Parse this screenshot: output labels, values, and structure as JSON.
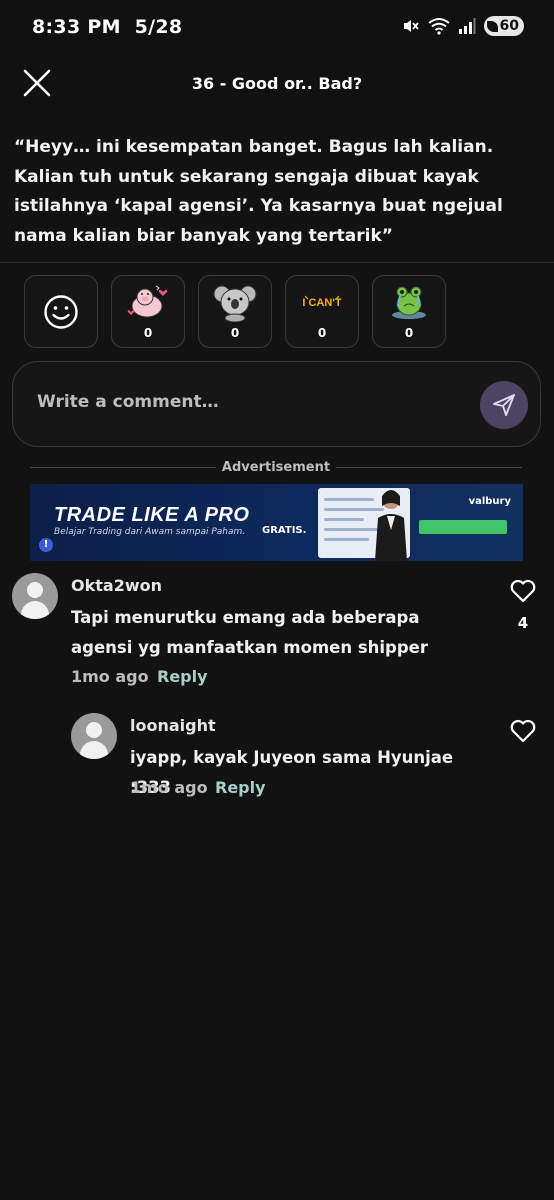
{
  "status_bar": {
    "time": "8:33 PM",
    "date": "5/28",
    "battery": "60",
    "icons": [
      "mute-icon",
      "wifi-icon",
      "signal-icon",
      "battery-icon"
    ]
  },
  "header": {
    "title": "36 - Good or.. Bad?",
    "close_icon": "close-icon"
  },
  "quote": {
    "text": "“Heyy… ini kesempatan banget. Bagus lah kalian. Kalian tuh untuk sekarang sengaja dibuat kayak istilahnya ‘kapal agensi’. Ya kasarnya buat ngejual nama kalian biar banyak yang tertarik”"
  },
  "reactions": {
    "add_icon": "smiley-face-icon",
    "items": [
      {
        "sticker": "pig-love-sticker",
        "count": "0"
      },
      {
        "sticker": "koala-sticker",
        "count": "0"
      },
      {
        "sticker": "i-cant-sticker",
        "label": "I CAN'T",
        "count": "0"
      },
      {
        "sticker": "frog-crying-sticker",
        "count": "0"
      }
    ]
  },
  "comment_box": {
    "placeholder": "Write a comment…",
    "send_icon": "send-icon"
  },
  "advertisement": {
    "label": "Advertisement",
    "headline": "TRADE LIKE A PRO",
    "subline": "Belajar Trading dari Awam sampai Paham.",
    "gratis": "GRATIS."
  },
  "comments": [
    {
      "author": "Okta2won",
      "text": "Tapi menurutku emang  ada beberapa agensi yg manfaatkan momen shipper",
      "time": "1mo ago",
      "reply_label": "Reply",
      "likes": "4"
    },
    {
      "author": "loonaight",
      "text": "iyapp, kayak Juyeon sama Hyunjae :333",
      "time": "1mo ago",
      "reply_label": "Reply",
      "likes": ""
    }
  ],
  "colors": {
    "background": "#121212",
    "accent_send": "#4b4563",
    "reply": "#a7ceca"
  }
}
